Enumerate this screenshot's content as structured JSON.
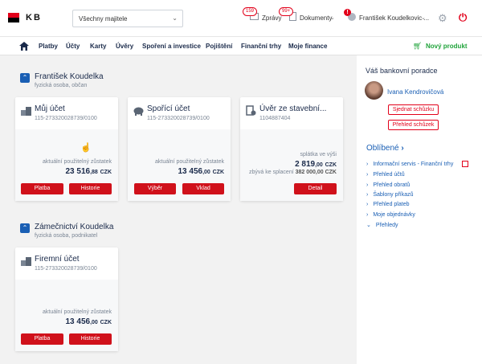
{
  "brand": {
    "name": "KB"
  },
  "header": {
    "owner_select": "Všechny majitele",
    "messages": {
      "label": "Zprávy",
      "count": "159"
    },
    "documents": {
      "label": "Dokumenty",
      "count": "99+"
    },
    "user": {
      "name": "František Koudelkovic ...",
      "alert": "!"
    }
  },
  "nav": {
    "items": [
      "Platby",
      "Účty",
      "Karty",
      "Úvěry",
      "Spoření a investice",
      "Pojištění",
      "Finanční trhy",
      "Moje finance"
    ],
    "new_product": "Nový produkt"
  },
  "owners": [
    {
      "name": "František Koudelka",
      "type": "fyzická osoba, občan",
      "cards": [
        {
          "title": "Můj účet",
          "number": "115-273320028739/0100",
          "label": "aktuální použitelný zůstatek",
          "amount_main": "23 516",
          "amount_dec": ",88",
          "currency": "CZK",
          "buttons": [
            "Platba",
            "Historie"
          ]
        },
        {
          "title": "Spořící účet",
          "number": "115-273320028739/0100",
          "label": "aktuální použitelný zůstatek",
          "amount_main": "13 456",
          "amount_dec": ",00",
          "currency": "CZK",
          "buttons": [
            "Výběr",
            "Vklad"
          ]
        },
        {
          "title": "Úvěr ze stavební...",
          "number": "1104887404",
          "label": "splátka ve výši",
          "amount_main": "2 819",
          "amount_dec": ",00",
          "currency": "CZK",
          "label2": "zbývá ke splacení",
          "amount2": "382 000,00 CZK",
          "buttons": [
            "Detail"
          ]
        }
      ]
    },
    {
      "name": "Zámečnictví Koudelka",
      "type": "fyzická osoba, podnikatel",
      "cards": [
        {
          "title": "Firemní účet",
          "number": "115-273320028739/0100",
          "label": "aktuální použitelný zůstatek",
          "amount_main": "13 456",
          "amount_dec": ",00",
          "currency": "CZK",
          "buttons": [
            "Platba",
            "Historie"
          ]
        }
      ]
    }
  ],
  "sidebar": {
    "advisor_title": "Váš bankovní poradce",
    "advisor_name": "Ivana Kendrovičová",
    "schedule_button": "Sjednat schůzku",
    "overview_button": "Přehled schůzek",
    "favorites_title": "Oblíbené",
    "favorites": [
      "Informační servis - Finanční trhy",
      "Přehled účtů",
      "Přehled obratů",
      "Šablony příkazů",
      "Přehled plateb",
      "Moje objednávky",
      "Přehledy"
    ]
  },
  "colors": {
    "accent": "#e2001a",
    "link": "#1a5fb4",
    "success": "#1fa33a"
  }
}
